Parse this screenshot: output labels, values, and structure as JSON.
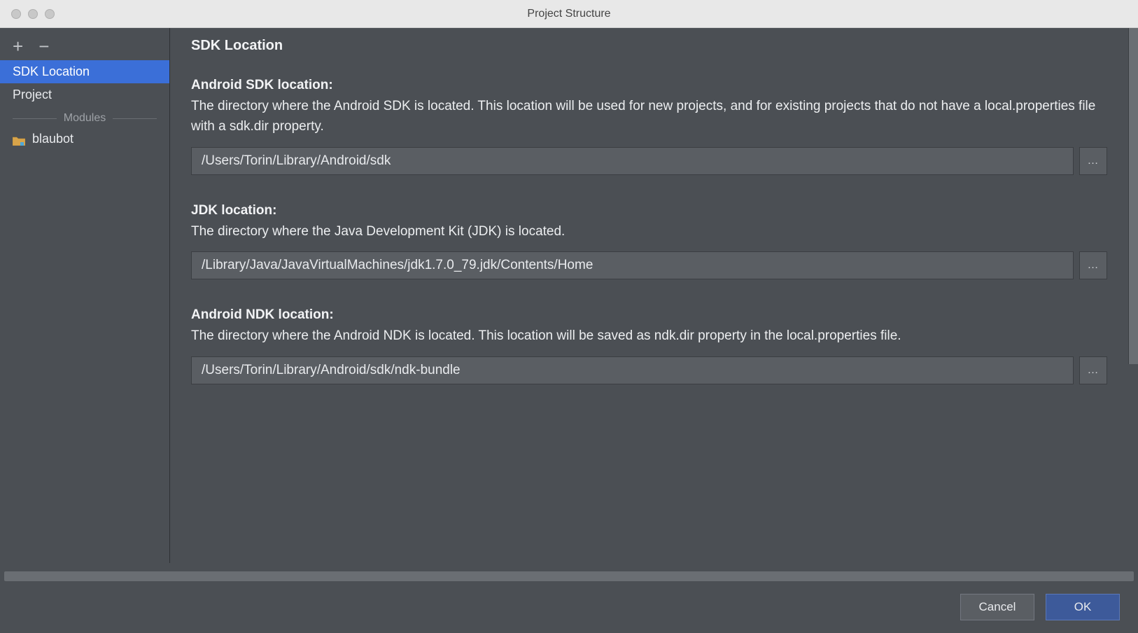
{
  "window": {
    "title": "Project Structure"
  },
  "sidebar": {
    "items": [
      {
        "label": "SDK Location",
        "selected": true
      },
      {
        "label": "Project",
        "selected": false
      }
    ],
    "modules_header": "Modules",
    "modules": [
      {
        "label": "blaubot"
      }
    ]
  },
  "main": {
    "title": "SDK Location",
    "sections": [
      {
        "label": "Android SDK location:",
        "description": "The directory where the Android SDK is located. This location will be used for new projects, and for existing projects that do not have a local.properties file with a sdk.dir property.",
        "value": "/Users/Torin/Library/Android/sdk"
      },
      {
        "label": "JDK location:",
        "description": "The directory where the Java Development Kit (JDK) is located.",
        "value": "/Library/Java/JavaVirtualMachines/jdk1.7.0_79.jdk/Contents/Home"
      },
      {
        "label": "Android NDK location:",
        "description": "The directory where the Android NDK is located. This location will be saved as ndk.dir property in the local.properties file.",
        "value": "/Users/Torin/Library/Android/sdk/ndk-bundle"
      }
    ],
    "browse_label": "…"
  },
  "buttons": {
    "cancel": "Cancel",
    "ok": "OK"
  }
}
